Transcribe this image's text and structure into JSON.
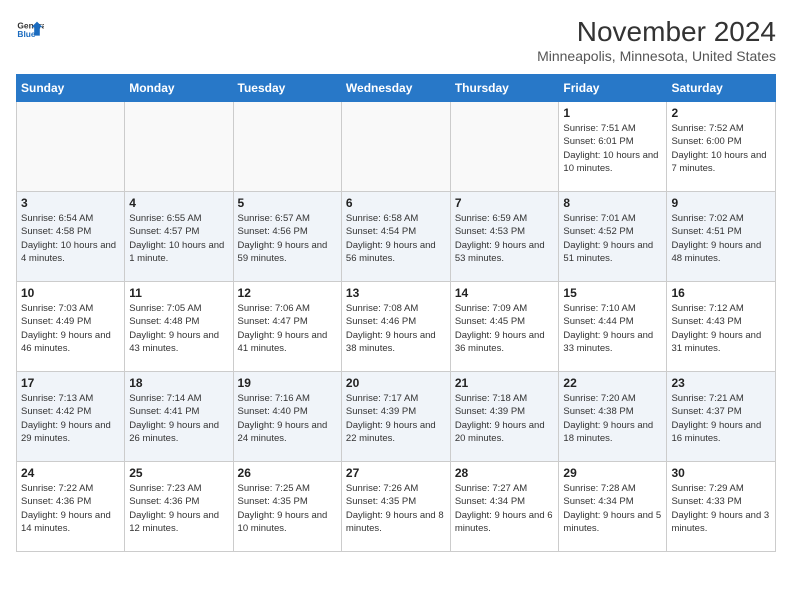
{
  "header": {
    "logo_line1": "General",
    "logo_line2": "Blue",
    "main_title": "November 2024",
    "subtitle": "Minneapolis, Minnesota, United States"
  },
  "weekdays": [
    "Sunday",
    "Monday",
    "Tuesday",
    "Wednesday",
    "Thursday",
    "Friday",
    "Saturday"
  ],
  "weeks": [
    [
      {
        "day": "",
        "info": ""
      },
      {
        "day": "",
        "info": ""
      },
      {
        "day": "",
        "info": ""
      },
      {
        "day": "",
        "info": ""
      },
      {
        "day": "",
        "info": ""
      },
      {
        "day": "1",
        "info": "Sunrise: 7:51 AM\nSunset: 6:01 PM\nDaylight: 10 hours and 10 minutes."
      },
      {
        "day": "2",
        "info": "Sunrise: 7:52 AM\nSunset: 6:00 PM\nDaylight: 10 hours and 7 minutes."
      }
    ],
    [
      {
        "day": "3",
        "info": "Sunrise: 6:54 AM\nSunset: 4:58 PM\nDaylight: 10 hours and 4 minutes."
      },
      {
        "day": "4",
        "info": "Sunrise: 6:55 AM\nSunset: 4:57 PM\nDaylight: 10 hours and 1 minute."
      },
      {
        "day": "5",
        "info": "Sunrise: 6:57 AM\nSunset: 4:56 PM\nDaylight: 9 hours and 59 minutes."
      },
      {
        "day": "6",
        "info": "Sunrise: 6:58 AM\nSunset: 4:54 PM\nDaylight: 9 hours and 56 minutes."
      },
      {
        "day": "7",
        "info": "Sunrise: 6:59 AM\nSunset: 4:53 PM\nDaylight: 9 hours and 53 minutes."
      },
      {
        "day": "8",
        "info": "Sunrise: 7:01 AM\nSunset: 4:52 PM\nDaylight: 9 hours and 51 minutes."
      },
      {
        "day": "9",
        "info": "Sunrise: 7:02 AM\nSunset: 4:51 PM\nDaylight: 9 hours and 48 minutes."
      }
    ],
    [
      {
        "day": "10",
        "info": "Sunrise: 7:03 AM\nSunset: 4:49 PM\nDaylight: 9 hours and 46 minutes."
      },
      {
        "day": "11",
        "info": "Sunrise: 7:05 AM\nSunset: 4:48 PM\nDaylight: 9 hours and 43 minutes."
      },
      {
        "day": "12",
        "info": "Sunrise: 7:06 AM\nSunset: 4:47 PM\nDaylight: 9 hours and 41 minutes."
      },
      {
        "day": "13",
        "info": "Sunrise: 7:08 AM\nSunset: 4:46 PM\nDaylight: 9 hours and 38 minutes."
      },
      {
        "day": "14",
        "info": "Sunrise: 7:09 AM\nSunset: 4:45 PM\nDaylight: 9 hours and 36 minutes."
      },
      {
        "day": "15",
        "info": "Sunrise: 7:10 AM\nSunset: 4:44 PM\nDaylight: 9 hours and 33 minutes."
      },
      {
        "day": "16",
        "info": "Sunrise: 7:12 AM\nSunset: 4:43 PM\nDaylight: 9 hours and 31 minutes."
      }
    ],
    [
      {
        "day": "17",
        "info": "Sunrise: 7:13 AM\nSunset: 4:42 PM\nDaylight: 9 hours and 29 minutes."
      },
      {
        "day": "18",
        "info": "Sunrise: 7:14 AM\nSunset: 4:41 PM\nDaylight: 9 hours and 26 minutes."
      },
      {
        "day": "19",
        "info": "Sunrise: 7:16 AM\nSunset: 4:40 PM\nDaylight: 9 hours and 24 minutes."
      },
      {
        "day": "20",
        "info": "Sunrise: 7:17 AM\nSunset: 4:39 PM\nDaylight: 9 hours and 22 minutes."
      },
      {
        "day": "21",
        "info": "Sunrise: 7:18 AM\nSunset: 4:39 PM\nDaylight: 9 hours and 20 minutes."
      },
      {
        "day": "22",
        "info": "Sunrise: 7:20 AM\nSunset: 4:38 PM\nDaylight: 9 hours and 18 minutes."
      },
      {
        "day": "23",
        "info": "Sunrise: 7:21 AM\nSunset: 4:37 PM\nDaylight: 9 hours and 16 minutes."
      }
    ],
    [
      {
        "day": "24",
        "info": "Sunrise: 7:22 AM\nSunset: 4:36 PM\nDaylight: 9 hours and 14 minutes."
      },
      {
        "day": "25",
        "info": "Sunrise: 7:23 AM\nSunset: 4:36 PM\nDaylight: 9 hours and 12 minutes."
      },
      {
        "day": "26",
        "info": "Sunrise: 7:25 AM\nSunset: 4:35 PM\nDaylight: 9 hours and 10 minutes."
      },
      {
        "day": "27",
        "info": "Sunrise: 7:26 AM\nSunset: 4:35 PM\nDaylight: 9 hours and 8 minutes."
      },
      {
        "day": "28",
        "info": "Sunrise: 7:27 AM\nSunset: 4:34 PM\nDaylight: 9 hours and 6 minutes."
      },
      {
        "day": "29",
        "info": "Sunrise: 7:28 AM\nSunset: 4:34 PM\nDaylight: 9 hours and 5 minutes."
      },
      {
        "day": "30",
        "info": "Sunrise: 7:29 AM\nSunset: 4:33 PM\nDaylight: 9 hours and 3 minutes."
      }
    ]
  ]
}
